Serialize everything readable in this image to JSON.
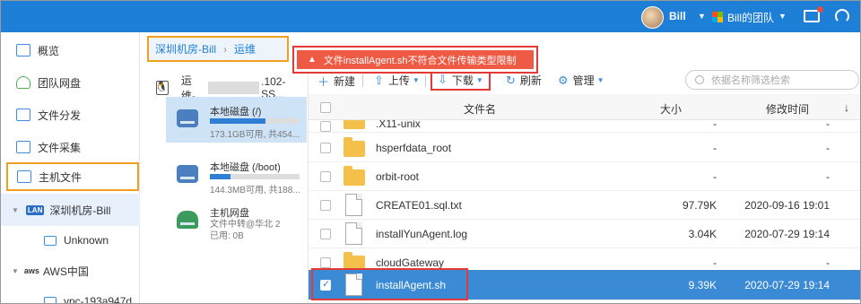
{
  "topbar": {
    "user_name": "Bill",
    "team_label": "Bill的团队",
    "accent": "#1e7fd6"
  },
  "sidebar": {
    "items": [
      {
        "label": "概览"
      },
      {
        "label": "团队网盘"
      },
      {
        "label": "文件分发"
      },
      {
        "label": "文件采集"
      },
      {
        "label": "主机文件"
      },
      {
        "label": "深圳机房-Bill",
        "badge": "LAN"
      },
      {
        "label": "Unknown"
      },
      {
        "label": "AWS中国",
        "badge": "aws"
      },
      {
        "label": "vpc-193a947d"
      }
    ]
  },
  "breadcrumb": {
    "items": [
      "深圳机房-Bill",
      "运维"
    ]
  },
  "device": {
    "title_prefix": "运维-",
    "title_suffix": ".102-SS...",
    "disks": [
      {
        "name": "本地磁盘 (/)",
        "info": "173.1GB可用, 共454...",
        "used_fraction": 0.62
      },
      {
        "name": "本地磁盘 (/boot)",
        "info": "144.3MB可用, 共188...",
        "used_fraction": 0.23
      },
      {
        "name": "主机网盘",
        "line2": "文件中转@华北 2",
        "line3": "已用: 0B"
      }
    ]
  },
  "toast": {
    "message": "文件installAgent.sh不符合文件传输类型限制",
    "color": "#ef5a45"
  },
  "toolbar": {
    "new_label": "新建",
    "upload_label": "上传",
    "download_label": "下载",
    "refresh_label": "刷新",
    "manage_label": "管理",
    "search_placeholder": "依据名称筛选检索"
  },
  "table": {
    "headers": {
      "name": "文件名",
      "size": "大小",
      "modified": "修改时间",
      "sort_icon": "↓"
    },
    "rows": [
      {
        "type": "folder",
        "name": ".X11-unix",
        "size": "-",
        "modified": "-"
      },
      {
        "type": "folder",
        "name": "hsperfdata_root",
        "size": "-",
        "modified": "-"
      },
      {
        "type": "folder",
        "name": "orbit-root",
        "size": "-",
        "modified": "-"
      },
      {
        "type": "file",
        "name": "CREATE01.sql.txt",
        "size": "97.79K",
        "modified": "2020-09-16 19:01"
      },
      {
        "type": "file",
        "name": "installYunAgent.log",
        "size": "3.04K",
        "modified": "2020-07-29 19:14"
      },
      {
        "type": "folder",
        "name": "cloudGateway",
        "size": "-",
        "modified": "-"
      },
      {
        "type": "file",
        "name": "installAgent.sh",
        "size": "9.39K",
        "modified": "2020-07-29 19:14",
        "selected": true
      }
    ]
  }
}
